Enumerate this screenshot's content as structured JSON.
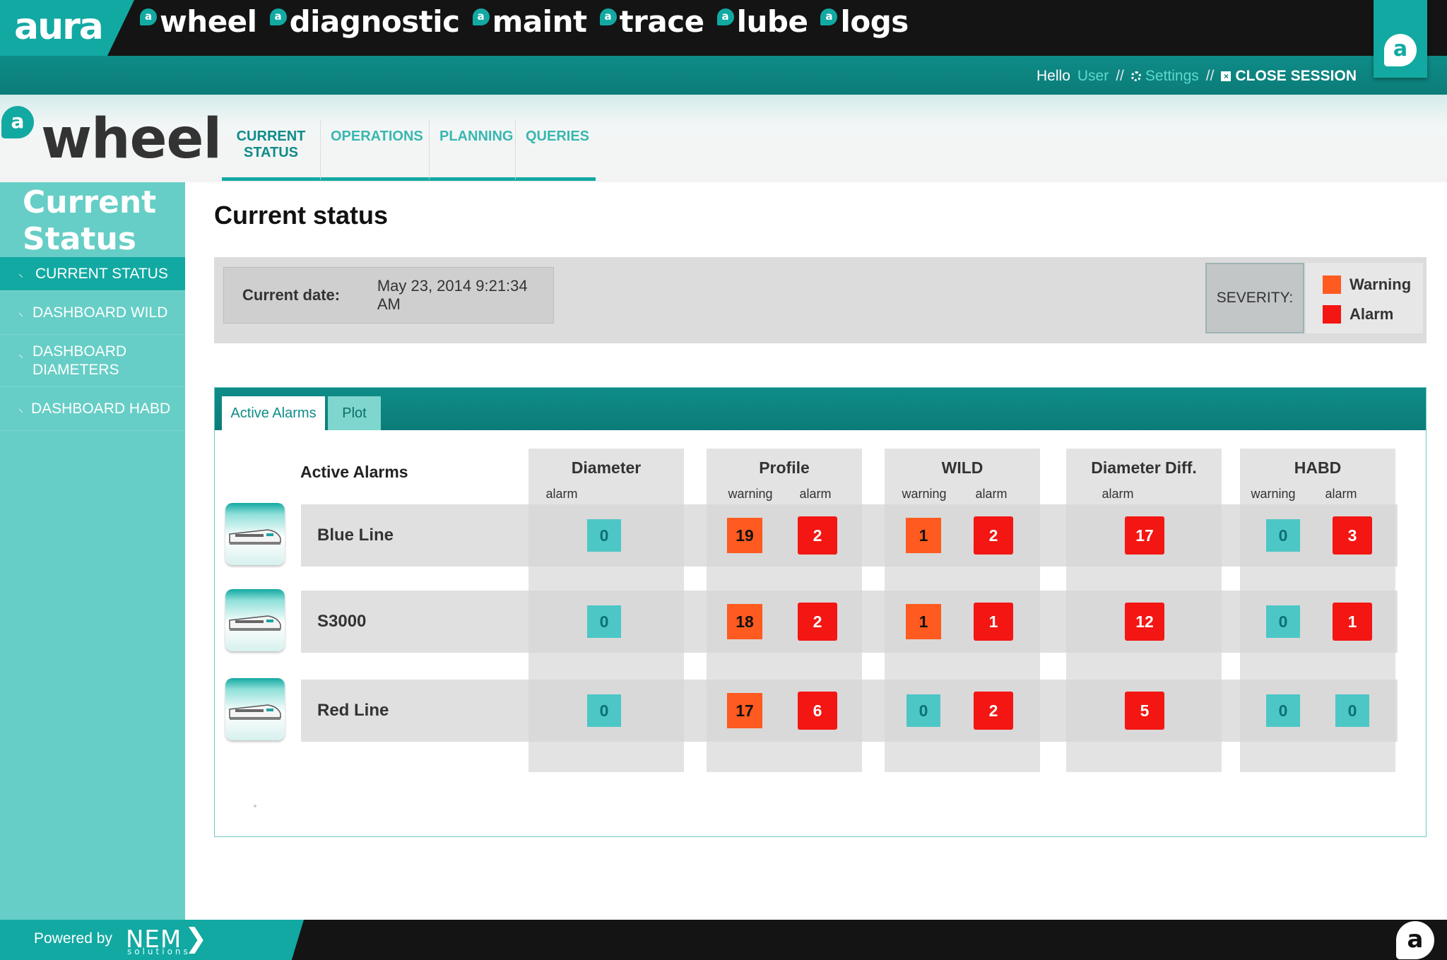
{
  "app": {
    "logo_text": "aura",
    "nav": [
      "wheel",
      "diagnostic",
      "maint",
      "trace",
      "lube",
      "logs"
    ],
    "nav_icon": "aura-a-icon"
  },
  "user_bar": {
    "hello": "Hello",
    "user": "User",
    "sep": "//",
    "settings": "Settings",
    "close_session": "CLOSE SESSION"
  },
  "module": {
    "title": "wheel",
    "tabs": [
      "CURRENT STATUS",
      "OPERATIONS",
      "PLANNING",
      "QUERIES"
    ],
    "active_tab": "CURRENT STATUS"
  },
  "sidebar": {
    "title": "Current Status",
    "items": [
      "CURRENT STATUS",
      "DASHBOARD WILD",
      "DASHBOARD DIAMETERS",
      "DASHBOARD HABD"
    ],
    "active_item": "CURRENT STATUS"
  },
  "main": {
    "title": "Current status",
    "date_label": "Current date:",
    "date_value": "May 23, 2014 9:21:34 AM",
    "severity_label": "SEVERITY:",
    "legend": [
      {
        "label": "Warning",
        "color": "#ff5a1f"
      },
      {
        "label": "Alarm",
        "color": "#f31612"
      }
    ]
  },
  "alarms": {
    "tabs": [
      "Active Alarms",
      "Plot"
    ],
    "active_tab": "Active Alarms",
    "title": "Active Alarms",
    "columns": [
      {
        "name": "Diameter",
        "sub": [
          "alarm"
        ]
      },
      {
        "name": "Profile",
        "sub": [
          "warning",
          "alarm"
        ]
      },
      {
        "name": "WILD",
        "sub": [
          "warning",
          "alarm"
        ]
      },
      {
        "name": "Diameter Diff.",
        "sub": [
          "alarm"
        ]
      },
      {
        "name": "HABD",
        "sub": [
          "warning",
          "alarm"
        ]
      }
    ],
    "rows": [
      {
        "name": "Blue Line",
        "values": [
          0,
          19,
          2,
          1,
          2,
          17,
          0,
          3
        ]
      },
      {
        "name": "S3000",
        "values": [
          0,
          18,
          2,
          1,
          1,
          12,
          0,
          1
        ]
      },
      {
        "name": "Red Line",
        "values": [
          0,
          17,
          6,
          0,
          2,
          5,
          0,
          0
        ]
      }
    ],
    "colors": {
      "ok": "#4cc7c6",
      "warning": "#ff5a1f",
      "alarm": "#f31612",
      "ok_text": "#0d6f7a",
      "warning_text": "#111111"
    }
  },
  "footer": {
    "powered_by": "Powered by",
    "brand": "NEM",
    "brand_sub": "solutions"
  }
}
